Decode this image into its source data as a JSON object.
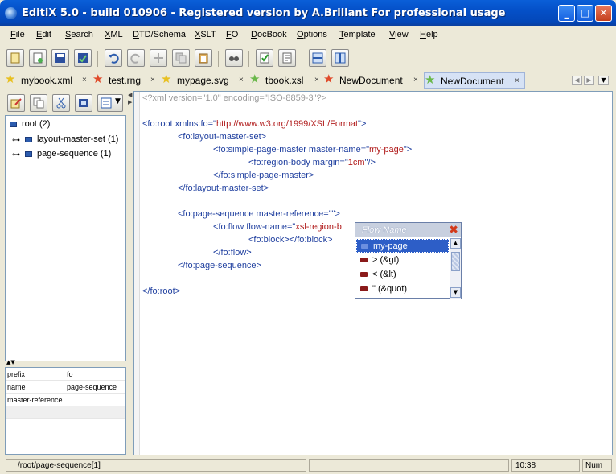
{
  "window": {
    "title": "EditiX 5.0 - build 010906 - Registered version by A.Brillant For professional usage",
    "buttons": {
      "minimize": "_",
      "maximize": "□",
      "close": "✕"
    }
  },
  "menu": [
    "File",
    "Edit",
    "Search",
    "XML",
    "DTD/Schema",
    "XSLT",
    "FO",
    "DocBook",
    "Options",
    "Template",
    "View",
    "Help"
  ],
  "menu_mnemonics": [
    "F",
    "E",
    "S",
    "X",
    "D",
    "X",
    "F",
    "D",
    "O",
    "T",
    "V",
    "H"
  ],
  "toolbar": {
    "buttons": [
      "new-document",
      "new-from-template",
      "save",
      "save-all",
      "undo",
      "redo",
      "cut",
      "copy",
      "paste",
      "search",
      "check-well-formed",
      "validate",
      "split-horizontal",
      "split-vertical"
    ]
  },
  "tabs": [
    {
      "label": "mybook.xml",
      "close": "×"
    },
    {
      "label": "test.rng",
      "close": "×"
    },
    {
      "label": "mypage.svg",
      "close": "×"
    },
    {
      "label": "tbook.xsl",
      "close": "×"
    },
    {
      "label": "NewDocument",
      "close": "×"
    },
    {
      "label": "NewDocument",
      "close": "×",
      "active": true
    }
  ],
  "tree": {
    "root": "root (2)",
    "children": [
      "layout-master-set (1)",
      "page-sequence (1)"
    ]
  },
  "properties": [
    {
      "key": "prefix",
      "value": "fo"
    },
    {
      "key": "name",
      "value": "page-sequence"
    },
    {
      "key": "master-reference",
      "value": ""
    }
  ],
  "editor": {
    "lines": [
      {
        "indent": 0,
        "parts": [
          [
            "pi",
            "<?xml version=\"1.0\" encoding=\"ISO-8859-3\"?>"
          ]
        ]
      },
      {
        "indent": 0,
        "parts": [
          [
            "tag",
            "<fo:root xmlns:fo=\""
          ],
          [
            "val",
            "http://www.w3.org/1999/XSL/Format"
          ],
          [
            "tag",
            "\">"
          ]
        ]
      },
      {
        "indent": 1,
        "parts": [
          [
            "tag",
            "<fo:layout-master-set>"
          ]
        ]
      },
      {
        "indent": 2,
        "parts": [
          [
            "tag",
            "<fo:simple-page-master master-name=\""
          ],
          [
            "val",
            "my-page"
          ],
          [
            "tag",
            "\">"
          ]
        ]
      },
      {
        "indent": 3,
        "parts": [
          [
            "tag",
            "<fo:region-body margin=\""
          ],
          [
            "val",
            "1cm"
          ],
          [
            "tag",
            "\"/>"
          ]
        ]
      },
      {
        "indent": 2,
        "parts": [
          [
            "tag",
            "</fo:simple-page-master>"
          ]
        ]
      },
      {
        "indent": 1,
        "parts": [
          [
            "tag",
            "</fo:layout-master-set>"
          ]
        ]
      },
      {
        "indent": 1,
        "parts": [
          [
            "tag",
            "<fo:page-sequence master-reference=\""
          ],
          [
            "val",
            ""
          ],
          [
            "tag",
            "\">"
          ]
        ]
      },
      {
        "indent": 2,
        "parts": [
          [
            "tag",
            "<fo:flow flow-name=\""
          ],
          [
            "val",
            "xsl-region-b"
          ]
        ]
      },
      {
        "indent": 3,
        "parts": [
          [
            "tag",
            "<fo:block></fo:block>"
          ]
        ]
      },
      {
        "indent": 2,
        "parts": [
          [
            "tag",
            "</fo:flow>"
          ]
        ]
      },
      {
        "indent": 1,
        "parts": [
          [
            "tag",
            "</fo:page-sequence>"
          ]
        ]
      },
      {
        "indent": 0,
        "parts": [
          [
            "tag",
            "</fo:root>"
          ]
        ]
      }
    ]
  },
  "popup": {
    "title": "Flow Name",
    "items": [
      "my-page",
      "> (&gt)",
      "< (&lt)",
      "\" (&quot)"
    ],
    "selected_index": 0
  },
  "status": {
    "path": "/root/page-sequence[1]",
    "time": "10:38",
    "num": "Num"
  },
  "colors": {
    "titlebar": "#0450c8",
    "tag": "#1f3f9f",
    "value": "#b11c1c",
    "pi": "#9b9b9b",
    "selection": "#2d5ec7"
  }
}
